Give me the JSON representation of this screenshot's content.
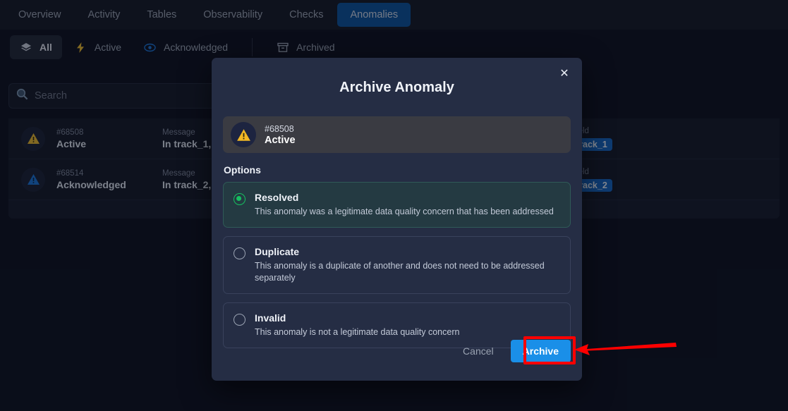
{
  "nav": {
    "tabs": [
      {
        "label": "Overview",
        "active": false
      },
      {
        "label": "Activity",
        "active": false
      },
      {
        "label": "Tables",
        "active": false
      },
      {
        "label": "Observability",
        "active": false
      },
      {
        "label": "Checks",
        "active": false
      },
      {
        "label": "Anomalies",
        "active": true
      }
    ],
    "active_color": "#0b539c"
  },
  "filters": [
    {
      "label": "All",
      "icon": "layers-icon",
      "active": true
    },
    {
      "label": "Active",
      "icon": "bolt-icon",
      "active": false
    },
    {
      "label": "Acknowledged",
      "icon": "eye-icon",
      "active": false
    },
    {
      "label": "Archived",
      "icon": "archive-icon",
      "active": false
    }
  ],
  "search": {
    "placeholder": "Search",
    "value": "",
    "icon": "search-icon"
  },
  "list": {
    "rows": [
      {
        "id": "#68508",
        "status": "Active",
        "severity": "warning",
        "message_label": "Message",
        "message_value": "In track_1,",
        "field_label": "Field",
        "field_value": "track_1"
      },
      {
        "id": "#68514",
        "status": "Acknowledged",
        "severity": "info",
        "message_label": "Message",
        "message_value": "In track_2,",
        "field_label": "Field",
        "field_value": "track_2"
      }
    ]
  },
  "modal": {
    "title": "Archive Anomaly",
    "close_icon": "close-icon",
    "banner": {
      "id": "#68508",
      "status": "Active",
      "icon": "warning-triangle-icon"
    },
    "options_header": "Options",
    "options": [
      {
        "title": "Resolved",
        "description": "This anomaly was a legitimate data quality concern that has been addressed",
        "selected": true
      },
      {
        "title": "Duplicate",
        "description": "This anomaly is a duplicate of another and does not need to be addressed separately",
        "selected": false
      },
      {
        "title": "Invalid",
        "description": "This anomaly is not a legitimate data quality concern",
        "selected": false
      }
    ],
    "cancel_label": "Cancel",
    "archive_label": "Archive",
    "archive_color": "#1a8fe8"
  },
  "annotation": {
    "highlight_color": "#ff0000",
    "arrow_color": "#ff0000"
  }
}
